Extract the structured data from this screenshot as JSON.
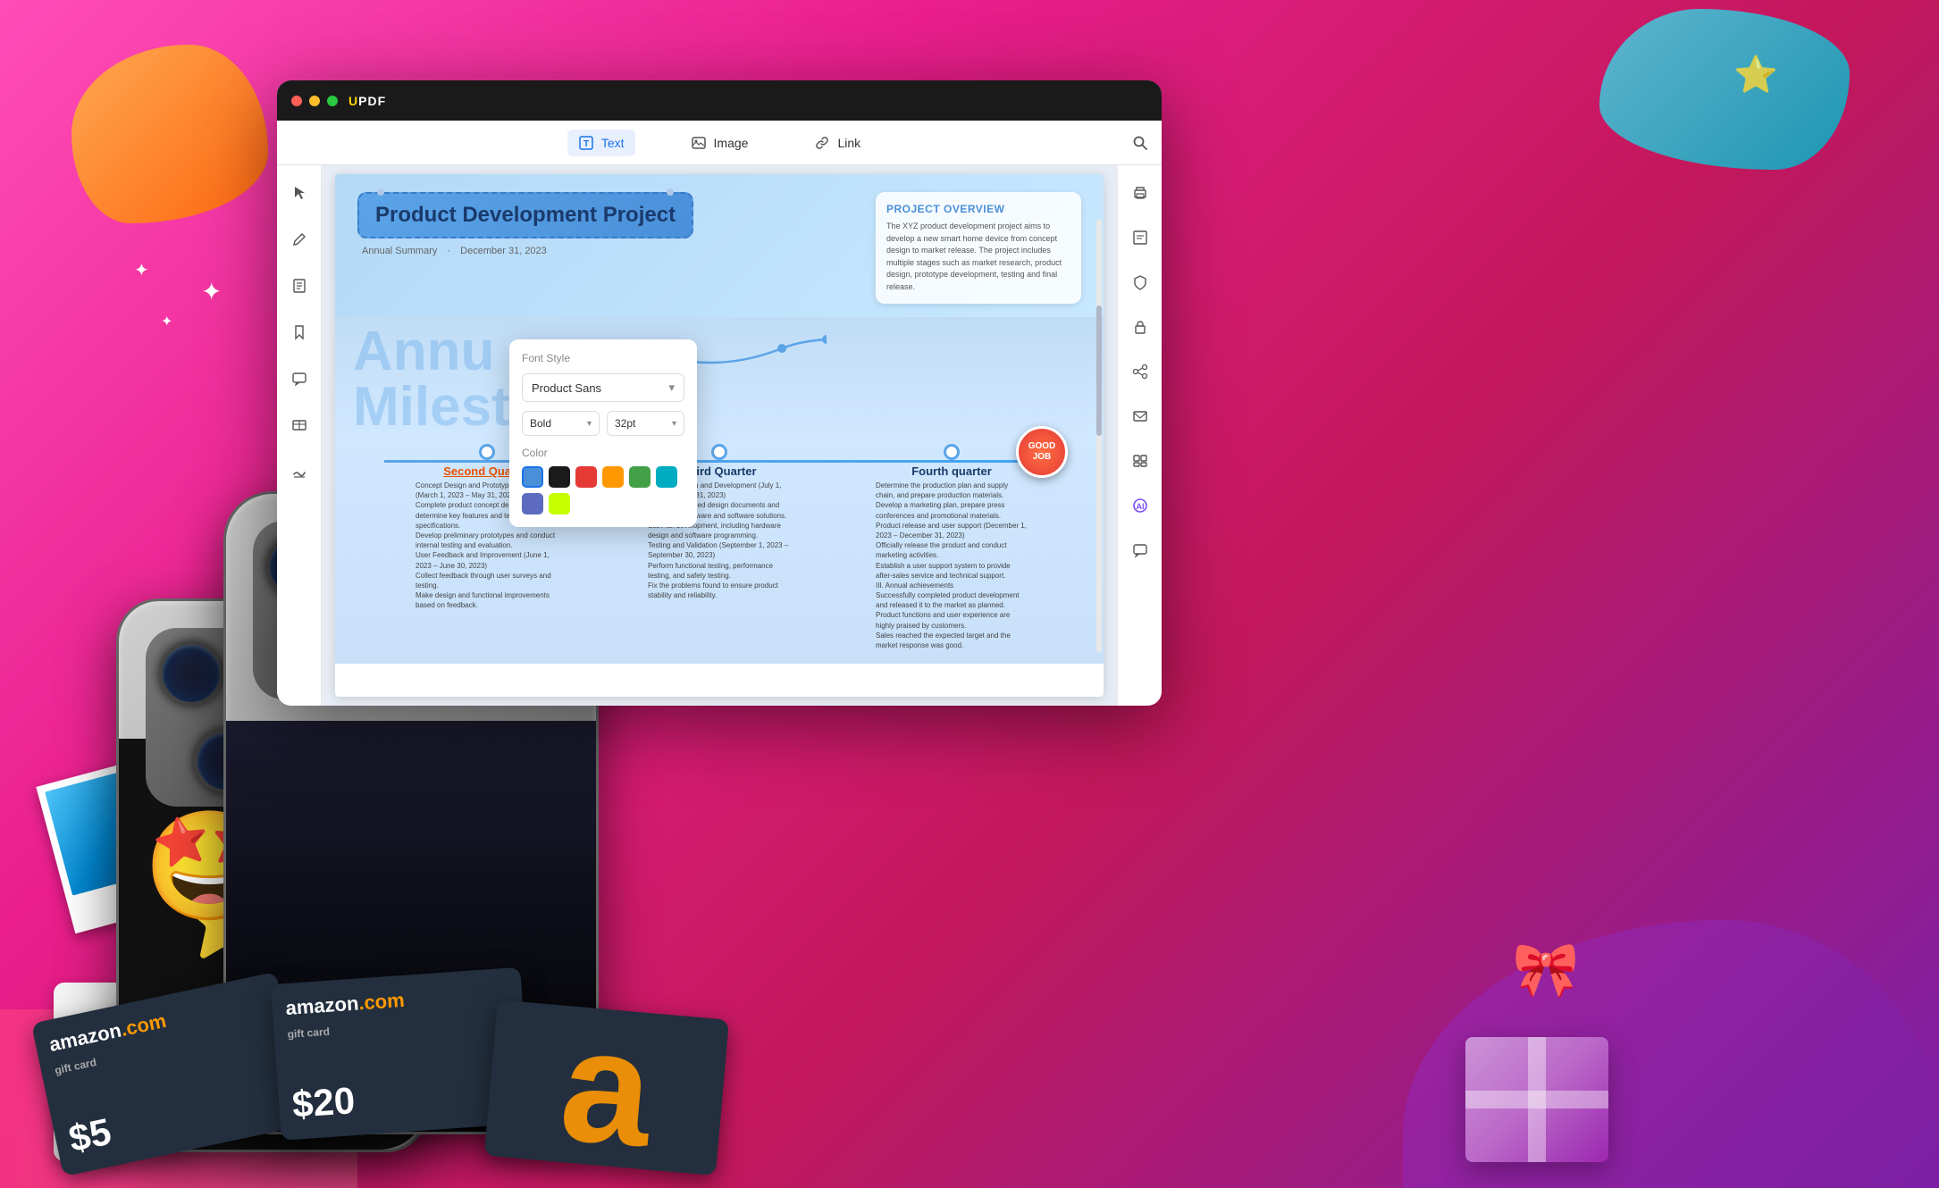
{
  "app": {
    "title": "UPDF",
    "title_u": "U",
    "title_pdf": "PDF"
  },
  "toolbar": {
    "text_label": "Text",
    "image_label": "Image",
    "link_label": "Link"
  },
  "sidebar_left": {
    "icons": [
      "📄",
      "📝",
      "🗂️",
      "📑",
      "🔖",
      "📌",
      "🔒"
    ]
  },
  "sidebar_right": {
    "icons": [
      "🖨️",
      "💾",
      "🔒",
      "📤",
      "📧",
      "📊",
      "💬"
    ]
  },
  "document": {
    "title": "Product Development Project",
    "subtitle_left": "Annual Summary",
    "subtitle_right": "December 31, 2023",
    "milestones_heading": "Annu",
    "milestones_heading2": "Milesto"
  },
  "project_overview": {
    "title": "PROJECT OVERVIEW",
    "text": "The XYZ product development project aims to develop a new smart home device from concept design to market release. The project includes multiple stages such as market research, product design, prototype development, testing and final release."
  },
  "timeline": {
    "second_quarter": {
      "label": "Second Quarter",
      "content": "Concept Design and Prototype Development (March 1, 2023 – May 31, 2023)\nComplete product concept design and determine key features and technical specifications.\nDevelop preliminary prototypes and conduct internal testing and evaluation.\nUser Feedback and Improvement (June 1, 2023 – June 30, 2023)\nCollect feedback through user surveys and testing.\nMake design and functional improvements based on feedback."
    },
    "third_quarter": {
      "label": "Third Quarter",
      "content": "Detailed Design and Development (July 1, 2023 – August 31, 2023)\nComplete detailed design documents and determine hardware and software solutions.\nStart full development, including hardware design and software programming.\nTesting and Validation (September 1, 2023 – September 30, 2023)\nPerform functional testing, performance testing, and safety testing.\nFix the problems found to ensure product stability and reliability."
    },
    "fourth_quarter": {
      "label": "Fourth quarter",
      "content": "Determine the production plan and supply chain, and prepare production materials.\nDevelop a marketing plan, prepare press conferences and promotional materials.\nProduct release and user support (December 1, 2023 – December 31, 2023)\nOfficially release the product and conduct marketing activities.\nEstablish a user support system to provide after-sales service and technical support.\nIII. Annual achievements\nSuccessfully completed product development and released it to the market as planned.\nProduct functions and user experience are highly praised by customers.\nSales reached the expected target and the market response was good."
    }
  },
  "font_popup": {
    "title": "Font Style",
    "font_name": "Product Sans",
    "weight": "Bold",
    "size": "32pt",
    "color_label": "Color",
    "colors": [
      {
        "name": "blue",
        "hex": "#4a90d9"
      },
      {
        "name": "black",
        "hex": "#1a1a1a"
      },
      {
        "name": "red",
        "hex": "#e53935"
      },
      {
        "name": "orange",
        "hex": "#ff9800"
      },
      {
        "name": "green",
        "hex": "#43a047"
      },
      {
        "name": "teal",
        "hex": "#00acc1"
      },
      {
        "name": "indigo",
        "hex": "#5c6bc0"
      },
      {
        "name": "lime",
        "hex": "#c6ff00"
      }
    ]
  },
  "gift_cards": [
    {
      "amount": "$5",
      "brand": "amazon.com"
    },
    {
      "amount": "$20",
      "brand": "amazon.com"
    }
  ],
  "badge": {
    "line1": "GOOD",
    "line2": "JOB"
  }
}
